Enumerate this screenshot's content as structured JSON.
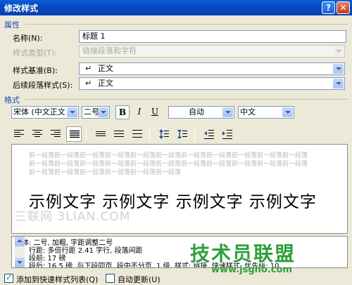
{
  "window": {
    "title": "修改样式"
  },
  "sections": {
    "properties": "属性",
    "format": "格式"
  },
  "properties": {
    "name": {
      "label": "名称(N):",
      "value": "标题 1"
    },
    "style_type": {
      "label": "样式类型(T):",
      "value": "链接段落和字符"
    },
    "style_based_on": {
      "label": "样式基准(B):",
      "value": "正文"
    },
    "following_style": {
      "label": "后续段落样式(S):",
      "value": "正文"
    }
  },
  "format": {
    "font": "宋体 (中文正文",
    "size": "二号",
    "bold": "B",
    "italic": "I",
    "underline": "U",
    "color": "自动",
    "language": "中文"
  },
  "preview": {
    "prev_para_line1": "前一段落前一段落前一段落前一段落前一段落前一段落前一段落前一段落前一段落前一段落前一段落",
    "prev_para_line2": "前一段落前一段落前一段落前一段落前一段落前一段落前一段落前一段落前一段落前一段落前一段落",
    "prev_para_line3": "前一段落前一段落前一段落前一段落前一段落前一段落",
    "sample_text": "示例文字 示例文字 示例文字 示例文字",
    "watermark": "三联网 3LIAN.COM"
  },
  "description": {
    "line1": "字体: 二号, 加粗, 字距调整二号",
    "line2": "行距: 多倍行距 2.41 字行, 段落间距",
    "line3": "段前: 17 磅",
    "line4": "段后: 16.5 磅, 与下段同页, 段中不分页, 1 级, 样式: 链接, 快速样式, 优先级: 10"
  },
  "site_watermark": {
    "title": "技术员联盟",
    "url": "www.jsgho.com"
  },
  "options": {
    "add_to_quick_styles": {
      "label": "添加到快速样式列表(Q)",
      "checked": true
    },
    "auto_update": {
      "label": "自动更新(U)",
      "checked": false
    }
  },
  "colors": {
    "titlebar": "#0a5fd6",
    "section_label": "#1d48b8",
    "watermark_green": "#2e9f3a"
  }
}
